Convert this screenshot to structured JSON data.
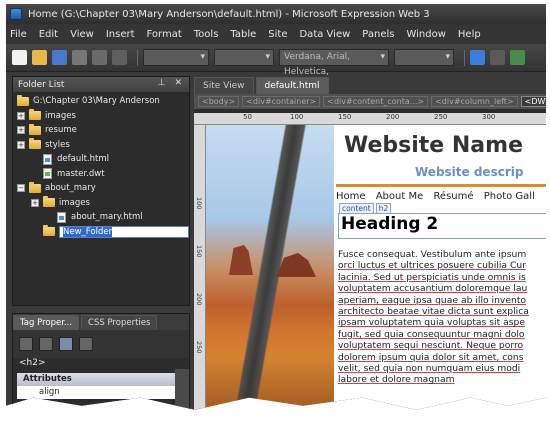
{
  "window": {
    "title": "Home (G:\\Chapter 03\\Mary Anderson\\default.html) - Microsoft Expression Web 3"
  },
  "menu": [
    "File",
    "Edit",
    "View",
    "Insert",
    "Format",
    "Tools",
    "Table",
    "Site",
    "Data View",
    "Panels",
    "Window",
    "Help"
  ],
  "toolbar": {
    "font_value": "Verdana, Arial, Helvetica,"
  },
  "folder_panel": {
    "title": "Folder List",
    "items": [
      {
        "label": "G:\\Chapter 03\\Mary Anderson",
        "type": "root",
        "indent": 0
      },
      {
        "label": "images",
        "type": "folder",
        "indent": 0,
        "exp": "+"
      },
      {
        "label": "resume",
        "type": "folder",
        "indent": 0,
        "exp": "+"
      },
      {
        "label": "styles",
        "type": "folder",
        "indent": 0,
        "exp": "+"
      },
      {
        "label": "default.html",
        "type": "html",
        "indent": 1
      },
      {
        "label": "master.dwt",
        "type": "dwt",
        "indent": 1
      },
      {
        "label": "about_mary",
        "type": "folder",
        "indent": 0,
        "exp": "−"
      },
      {
        "label": "images",
        "type": "folder",
        "indent": 1,
        "exp": "+"
      },
      {
        "label": "about_mary.html",
        "type": "html",
        "indent": 2
      },
      {
        "label": "New_Folder",
        "type": "rename",
        "indent": 1
      }
    ]
  },
  "tag_panel": {
    "tabs": [
      "Tag Proper...",
      "CSS Properties"
    ],
    "tag": "<h2>",
    "section": "Attributes",
    "rows": [
      "align"
    ]
  },
  "editor": {
    "tabs": [
      "Site View",
      "default.html"
    ],
    "breadcrumbs": [
      "<body>",
      "<div#container>",
      "<div#content_conta...>",
      "<div#column_left>",
      "<DWT:edita"
    ],
    "ruler": [
      "50",
      "100",
      "150",
      "200",
      "250",
      "300"
    ],
    "vruler": [
      "100",
      "150",
      "200",
      "250"
    ],
    "page": {
      "site_name": "Website Name",
      "site_description": "Website descrip",
      "nav": [
        "Home",
        "About Me",
        "Résumé",
        "Photo Gall"
      ],
      "content_tags": [
        "content",
        "h2"
      ],
      "heading": "Heading 2",
      "body_lines": [
        "Fusce consequat. Vestibulum ante ipsum",
        "orci luctus et ultrices posuere cubilia Cur",
        "lacinia. Sed ut perspiciatis unde omnis is",
        "voluptatem accusantium doloremque lau",
        "aperiam, eaque ipsa quae ab illo invento",
        "architecto beatae vitae dicta sunt explica",
        "ipsam voluptatem quia voluptas sit aspe",
        "fugit, sed quia consequuntur magni dolo",
        "voluptatem sequi nesciunt. Neque porro",
        "dolorem ipsum quia dolor sit amet, cons",
        "velit, sed quia non numquam eius modi",
        "labore et dolore magnam"
      ]
    }
  }
}
